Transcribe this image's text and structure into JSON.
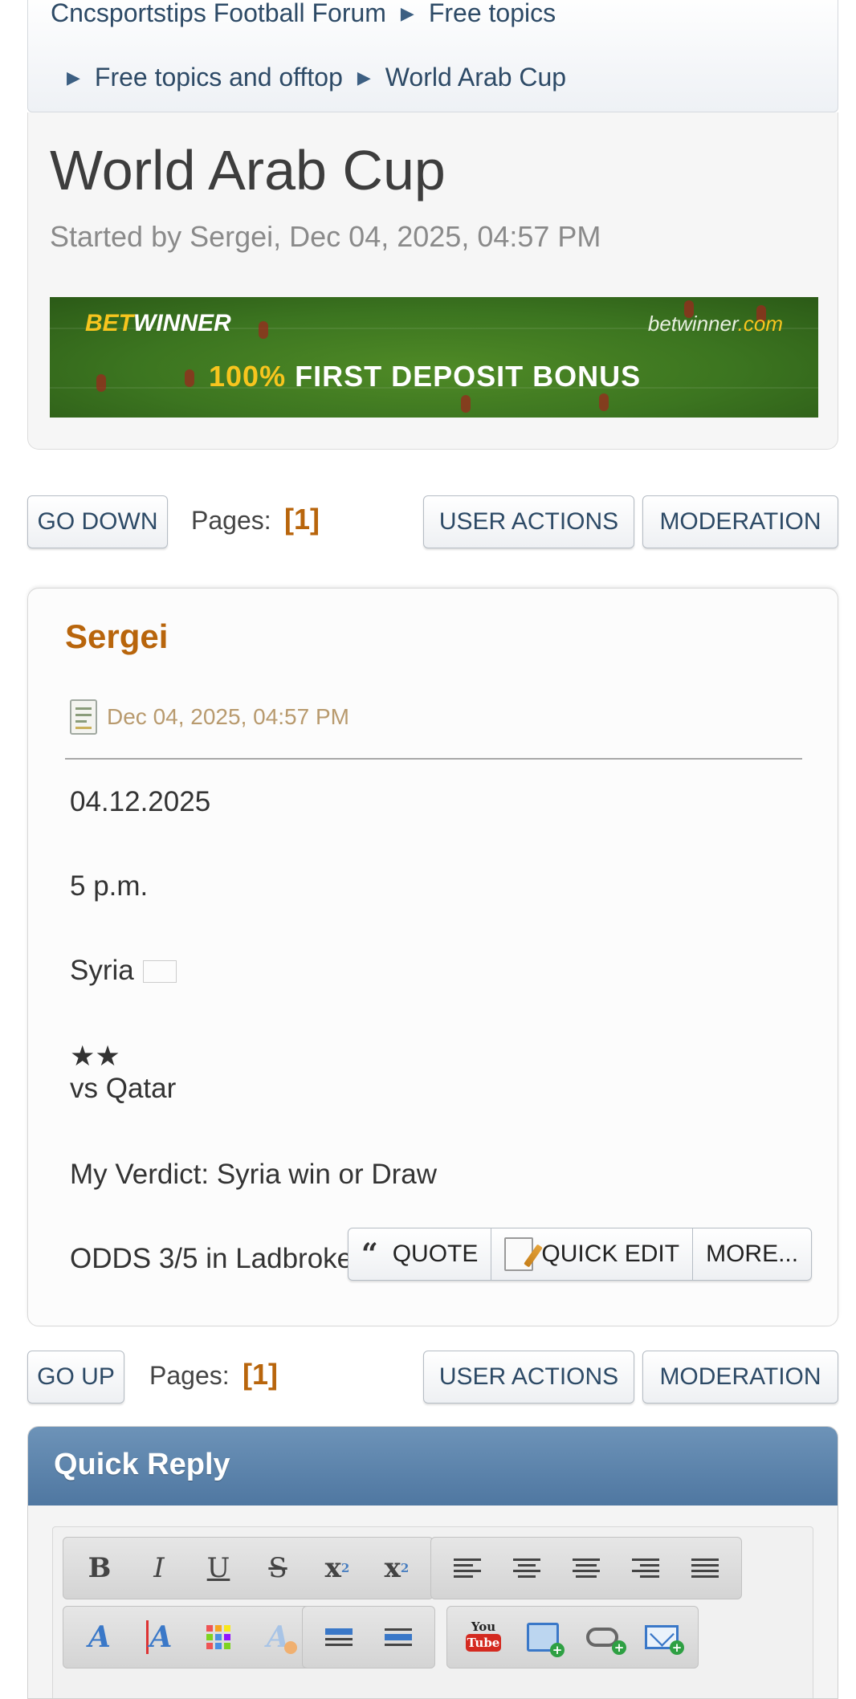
{
  "breadcrumb": {
    "forum": "Cncsportstips Football Forum",
    "board": "Free topics",
    "subboard": "Free topics and offtop",
    "topic": "World Arab Cup"
  },
  "topic": {
    "title": "World Arab Cup",
    "started": "Started by Sergei, Dec 04, 2025, 04:57 PM"
  },
  "banner": {
    "brand_bet": "BET",
    "brand_winner": "WINNER",
    "domain_name": "betwinner",
    "domain_tld": ".com",
    "pct": "100%",
    "text": " FIRST DEPOSIT BONUS"
  },
  "nav_top": {
    "go_down": "GO DOWN",
    "pages_label": "Pages:",
    "pages_current": "[1]",
    "user_actions": "USER ACTIONS",
    "moderation": "MODERATION"
  },
  "post": {
    "author": "Sergei",
    "date": "Dec 04, 2025, 04:57 PM",
    "lines": {
      "date": "04.12.2025",
      "time": "5 p.m.",
      "match_home": "Syria",
      "match_rest": " vs Qatar",
      "verdict": "My Verdict: Syria win or Draw",
      "odds": "ODDS 3/5 in Ladbrokes"
    },
    "actions": {
      "quote": "QUOTE",
      "quick_edit": "QUICK EDIT",
      "more": "MORE..."
    }
  },
  "nav_bottom": {
    "go_up": "GO UP",
    "pages_label": "Pages:",
    "pages_current": "[1]",
    "user_actions": "USER ACTIONS",
    "moderation": "MODERATION"
  },
  "quick_reply": {
    "title": "Quick Reply",
    "youtube_you": "You",
    "youtube_tube": "Tube"
  },
  "colors": {
    "accent_orange": "#b8650c",
    "link_blue": "#2d4a66",
    "header_blue": "#5b82aa",
    "banner_green": "#3c7520"
  },
  "icons": [
    "post-icon",
    "quote-icon",
    "edit-icon",
    "bold-icon",
    "italic-icon",
    "underline-icon",
    "strike-icon",
    "superscript-icon",
    "subscript-icon",
    "align-left-icon",
    "align-center-icon",
    "align-right-icon",
    "justify-icon",
    "font-face-icon",
    "font-size-icon",
    "color-icon",
    "remove-format-icon",
    "youtube-icon",
    "image-icon",
    "link-icon",
    "email-icon",
    "syria-flag-icon"
  ]
}
